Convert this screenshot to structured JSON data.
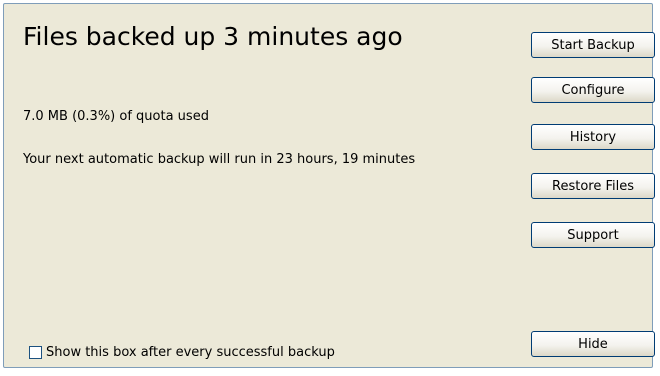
{
  "status": {
    "title": "Files backed up 3 minutes ago",
    "quota_text": "7.0 MB (0.3%) of quota used",
    "next_backup_text": "Your next automatic backup will run in 23 hours, 19 minutes"
  },
  "buttons": {
    "start_backup": "Start Backup",
    "configure": "Configure",
    "history": "History",
    "restore_files": "Restore Files",
    "support": "Support",
    "hide": "Hide"
  },
  "footer": {
    "checkbox_label": "Show this box after every successful backup",
    "checkbox_checked": false
  }
}
